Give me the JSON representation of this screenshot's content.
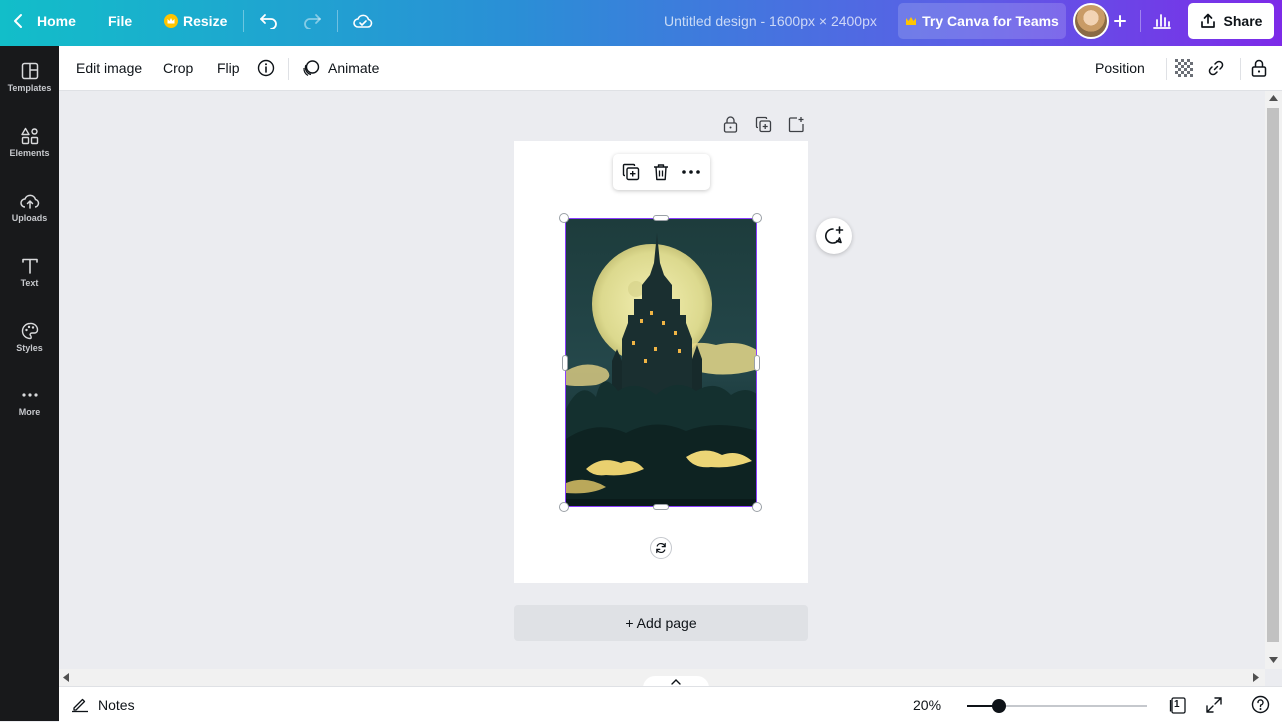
{
  "topbar": {
    "home_label": "Home",
    "file_label": "File",
    "resize_label": "Resize",
    "doc_title": "Untitled design - 1600px × 2400px",
    "teams_label": "Try Canva for Teams",
    "share_label": "Share",
    "accent_gradient": [
      "#12bec9",
      "#7d2ae8"
    ],
    "crown_color": "#ffc400"
  },
  "sidebar": {
    "items": [
      {
        "label": "Templates",
        "icon": "templates-icon"
      },
      {
        "label": "Elements",
        "icon": "elements-icon"
      },
      {
        "label": "Uploads",
        "icon": "uploads-icon"
      },
      {
        "label": "Text",
        "icon": "text-icon"
      },
      {
        "label": "Styles",
        "icon": "styles-icon"
      },
      {
        "label": "More",
        "icon": "more-icon"
      }
    ]
  },
  "context_toolbar": {
    "edit_image": "Edit image",
    "crop": "Crop",
    "flip": "Flip",
    "animate": "Animate",
    "position": "Position"
  },
  "canvas": {
    "add_page": "+ Add page",
    "selection_color": "#8b3dff",
    "image_subject": "castle-moon-illustration"
  },
  "bottombar": {
    "notes_label": "Notes",
    "zoom_label": "20%",
    "zoom_fraction": 0.18,
    "page_count": "1"
  }
}
